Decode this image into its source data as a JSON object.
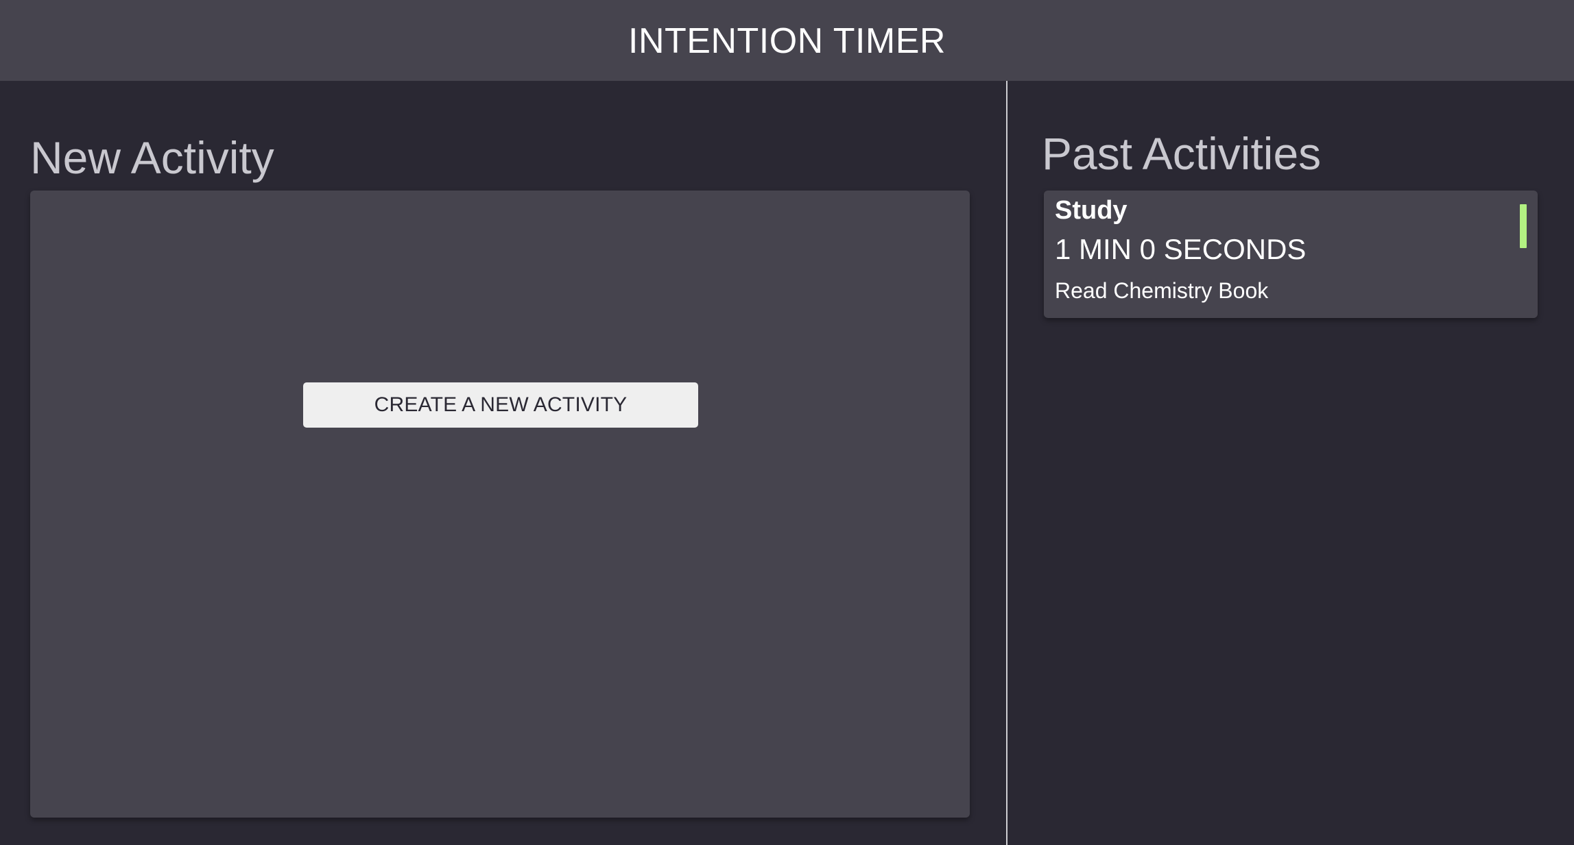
{
  "header": {
    "title": "INTENTION TIMER"
  },
  "new_activity": {
    "heading": "New Activity",
    "create_button_label": "CREATE A NEW ACTIVITY"
  },
  "past_activities": {
    "heading": "Past Activities",
    "items": [
      {
        "category": "Study",
        "duration": "1 MIN 0 SECONDS",
        "description": "Read Chemistry Book",
        "indicator_color": "#b3f182"
      }
    ]
  },
  "colors": {
    "background": "#2a2833",
    "panel": "#46444e",
    "heading_text": "#c9c8cf",
    "button_bg": "#efefef",
    "study_accent": "#b3f182"
  }
}
